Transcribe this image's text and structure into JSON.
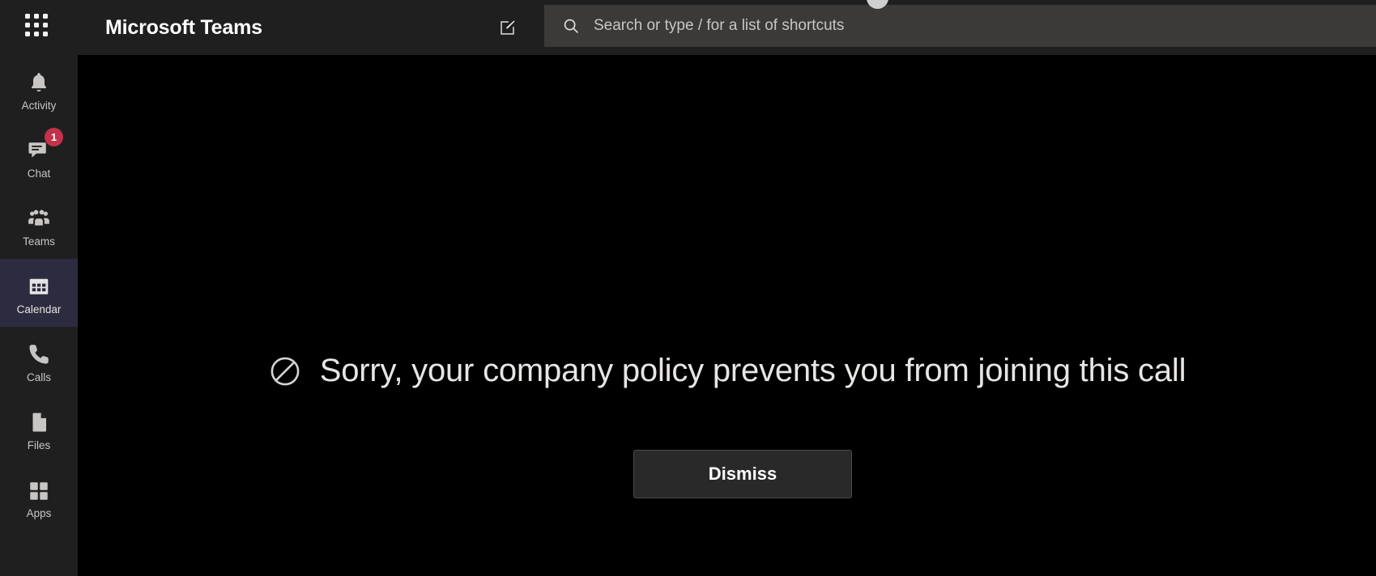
{
  "header": {
    "app_title": "Microsoft Teams",
    "app_launcher_icon": "grid-apps-icon",
    "compose_icon": "compose-edit-icon",
    "search": {
      "icon": "search-icon",
      "value": "",
      "placeholder": "Search or type / for a list of shortcuts"
    }
  },
  "sidebar": {
    "items": [
      {
        "label": "Activity",
        "icon": "bell-icon",
        "active": false,
        "badge": null
      },
      {
        "label": "Chat",
        "icon": "chat-bubble-icon",
        "active": false,
        "badge": "1"
      },
      {
        "label": "Teams",
        "icon": "people-icon",
        "active": false,
        "badge": null
      },
      {
        "label": "Calendar",
        "icon": "calendar-icon",
        "active": true,
        "badge": null
      },
      {
        "label": "Calls",
        "icon": "phone-icon",
        "active": false,
        "badge": null
      },
      {
        "label": "Files",
        "icon": "file-document-icon",
        "active": false,
        "badge": null
      },
      {
        "label": "Apps",
        "icon": "apps-grid-icon",
        "active": false,
        "badge": null
      }
    ]
  },
  "main": {
    "status_icon": "blocked-circle-slash-icon",
    "message": "Sorry, your company policy prevents you from joining this call",
    "dismiss_label": "Dismiss"
  },
  "colors": {
    "chrome": "#201f1f",
    "stage": "#000000",
    "search_field": "#3b3a39",
    "active_item": "#2d2b40",
    "badge_red": "#c4314b",
    "text_primary": "#ffffff",
    "text_secondary": "#c8c6c4",
    "button_fill": "#292929",
    "button_border": "#4a4a4a"
  }
}
